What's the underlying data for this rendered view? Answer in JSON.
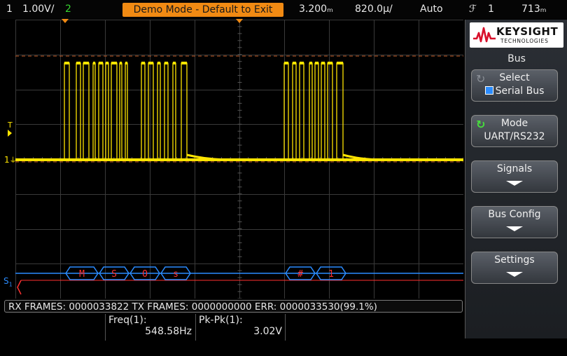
{
  "topbar": {
    "ch1_label": "1",
    "ch1_scale": "1.00V/",
    "ch2_label": "2",
    "demo_banner": "Demo Mode - Default to Exit",
    "time_delay": "3.200ₘ",
    "timebase": "820.0µ/",
    "trigger_mode": "Auto",
    "trigger_slope": "ℱ",
    "trigger_channel": "1",
    "trigger_level": "713ₘ"
  },
  "waveform": {
    "ground_marker": "1",
    "trigger_marker": "T",
    "serial_marker": "S",
    "serial_marker_sub": "1",
    "decode_symbols_group1": [
      "M",
      "S",
      "O",
      "s"
    ],
    "decode_symbols_group2": [
      "#",
      "1"
    ]
  },
  "status": {
    "text": "RX FRAMES: 0000033822  TX FRAMES: 0000000000  ERR: 0000033530(99.1%)"
  },
  "measurements": [
    {
      "label": "Freq(1):",
      "value": "548.58Hz"
    },
    {
      "label": "Pk-Pk(1):",
      "value": "3.02V"
    }
  ],
  "right_panel": {
    "logo_text": "KEYSIGHT",
    "logo_sub": "TECHNOLOGIES",
    "title": "Bus",
    "softkeys": [
      {
        "line1": "Select",
        "line2": "Serial Bus"
      },
      {
        "line1": "Mode",
        "line2": "UART/RS232"
      },
      {
        "line1": "Signals",
        "line2": ""
      },
      {
        "line1": "Bus Config",
        "line2": ""
      },
      {
        "line1": "Settings",
        "line2": ""
      }
    ]
  },
  "colors": {
    "ch1": "#ffe500",
    "ch2": "#37d62f",
    "bus": "#2b8cff",
    "decode_text": "#ff3030",
    "accent_orange": "#f18a13"
  }
}
